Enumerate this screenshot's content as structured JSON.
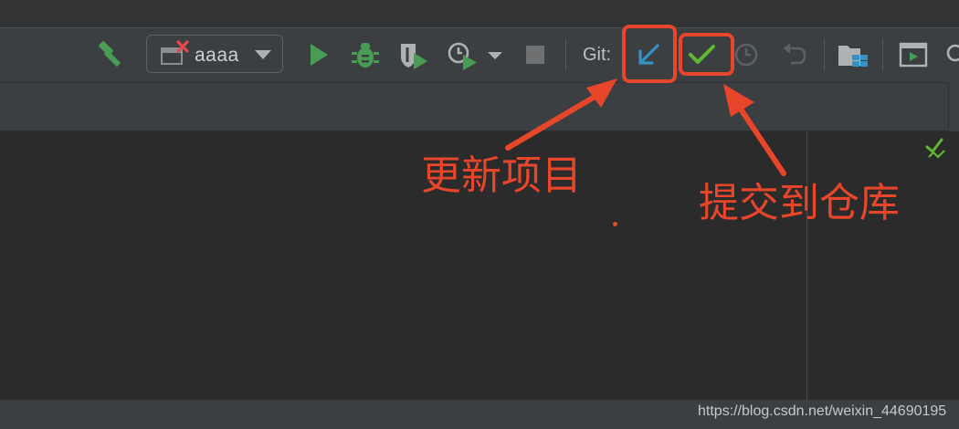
{
  "toolbar": {
    "run_config": {
      "name": "aaaa"
    },
    "git_label": "Git:",
    "icons": [
      "build-hammer-icon",
      "run-config-error-icon",
      "dropdown-arrow-icon",
      "run-icon",
      "debug-icon",
      "coverage-icon",
      "profiler-icon",
      "stop-icon",
      "vcs-update-icon",
      "vcs-commit-icon",
      "history-icon",
      "rollback-icon",
      "project-structure-icon",
      "presentation-icon",
      "search-icon"
    ]
  },
  "annotations": {
    "update_label": "更新项目",
    "commit_label": "提交到仓库",
    "color": "#e8462b"
  },
  "watermark": "https://blog.csdn.net/weixin_44690195",
  "colors": {
    "toolbar_bg": "#3c3f41",
    "editor_bg": "#2b2b2b",
    "run_green": "#499c54",
    "update_blue": "#3592c4",
    "commit_green": "#5fb832"
  }
}
